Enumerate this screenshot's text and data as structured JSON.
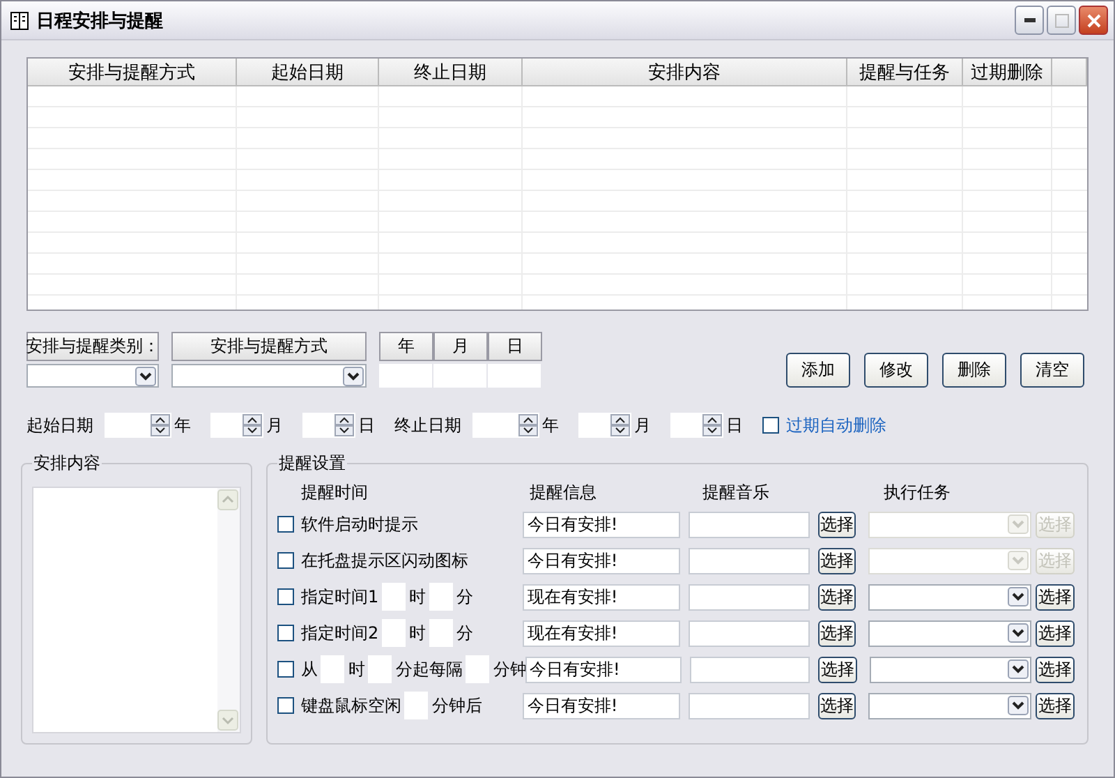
{
  "window": {
    "title": "日程安排与提醒"
  },
  "table": {
    "columns": [
      "安排与提醒方式",
      "起始日期",
      "终止日期",
      "安排内容",
      "提醒与任务",
      "过期删除"
    ]
  },
  "filters": {
    "category_label": "安排与提醒类别：",
    "method_label": "安排与提醒方式",
    "date_headers": [
      "年",
      "月",
      "日"
    ]
  },
  "buttons": [
    "添加",
    "修改",
    "删除",
    "清空"
  ],
  "date_range": {
    "start_label": "起始日期",
    "start_units": [
      "年",
      "月",
      "日"
    ],
    "end_label": "终止日期",
    "end_units": [
      "年",
      "月",
      "日"
    ],
    "auto_delete": {
      "label": "过期自动删除",
      "checked": false
    }
  },
  "content_box": {
    "title": "安排内容"
  },
  "reminder": {
    "title": "提醒设置",
    "headers": [
      "提醒时间",
      "提醒信息",
      "提醒音乐",
      "执行任务"
    ],
    "rows": [
      {
        "checked": false,
        "parts": [
          {
            "kind": "text",
            "text": "软件启动时提示"
          }
        ],
        "message": "今日有安排!",
        "music_button": "选择",
        "task_disabled": true,
        "task_button": "选择"
      },
      {
        "checked": false,
        "parts": [
          {
            "kind": "text",
            "text": "在托盘提示区闪动图标"
          }
        ],
        "message": "今日有安排!",
        "music_button": "选择",
        "task_disabled": true,
        "task_button": "选择"
      },
      {
        "checked": false,
        "parts": [
          {
            "kind": "text",
            "text": "指定时间1"
          },
          {
            "kind": "box"
          },
          {
            "kind": "text",
            "text": "时"
          },
          {
            "kind": "box"
          },
          {
            "kind": "text",
            "text": "分"
          }
        ],
        "message": "现在有安排!",
        "music_button": "选择",
        "task_disabled": false,
        "task_button": "选择"
      },
      {
        "checked": false,
        "parts": [
          {
            "kind": "text",
            "text": "指定时间2"
          },
          {
            "kind": "box"
          },
          {
            "kind": "text",
            "text": "时"
          },
          {
            "kind": "box"
          },
          {
            "kind": "text",
            "text": "分"
          }
        ],
        "message": "现在有安排!",
        "music_button": "选择",
        "task_disabled": false,
        "task_button": "选择"
      },
      {
        "checked": false,
        "parts": [
          {
            "kind": "text",
            "text": "从"
          },
          {
            "kind": "box"
          },
          {
            "kind": "text",
            "text": "时"
          },
          {
            "kind": "box"
          },
          {
            "kind": "text",
            "text": "分起每隔"
          },
          {
            "kind": "box"
          },
          {
            "kind": "text",
            "text": "分钟"
          }
        ],
        "message": "今日有安排!",
        "music_button": "选择",
        "task_disabled": false,
        "task_button": "选择"
      },
      {
        "checked": false,
        "parts": [
          {
            "kind": "text",
            "text": "键盘鼠标空闲"
          },
          {
            "kind": "box"
          },
          {
            "kind": "text",
            "text": "分钟后"
          }
        ],
        "message": "今日有安排!",
        "music_button": "选择",
        "task_disabled": false,
        "task_button": "选择"
      }
    ]
  }
}
